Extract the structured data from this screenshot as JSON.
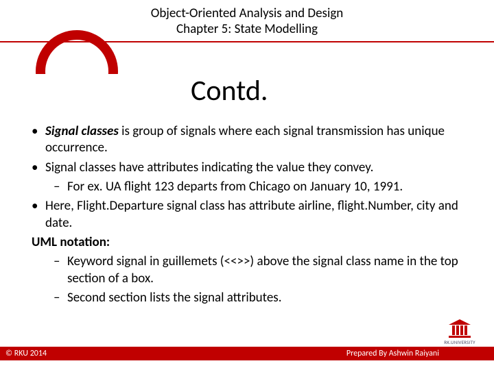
{
  "header": {
    "course": "Object-Oriented Analysis and Design",
    "chapter": "Chapter 5: State Modelling"
  },
  "title": "Contd.",
  "bullets": {
    "p1_lead": "Signal classes",
    "p1_rest": "  is group of signals where each signal transmission has unique occurrence.",
    "p2": "Signal classes have attributes indicating the value they convey.",
    "p2_ex": "For ex.  UA flight 123 departs from Chicago on January 10, 1991.",
    "p3": "Here, Flight.Departure signal class has attribute airline, flight.Number, city and date.",
    "uml_label": "UML notation:",
    "uml_1": "Keyword signal in guillemets (<<>>) above the signal class name in the top section of a box.",
    "uml_2": "Second section lists the signal attributes."
  },
  "footer": {
    "left": "© RKU 2014",
    "right": "Prepared By Ashwin Raiyani",
    "logo_text": "RK.UNIVERSITY"
  }
}
